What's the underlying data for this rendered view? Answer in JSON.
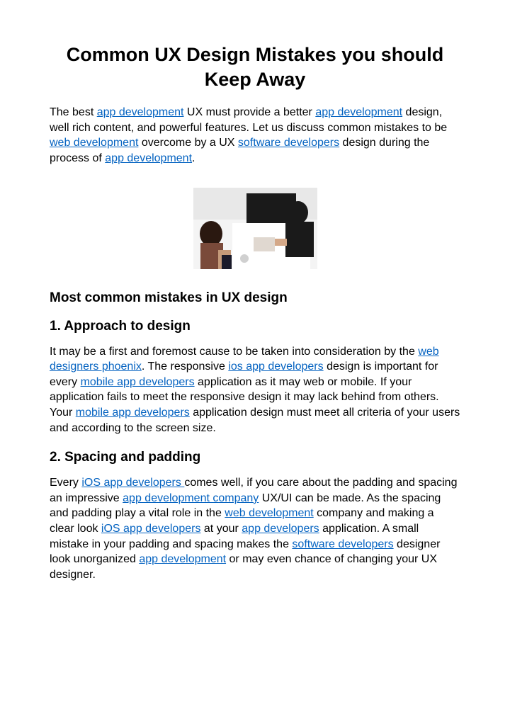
{
  "title": "Common UX Design Mistakes you should Keep Away",
  "intro": {
    "t1": "The best ",
    "l1": "app development",
    "t2": " UX must provide a better ",
    "l2": "app development",
    "t3": " design, well rich content, and powerful features. Let us discuss common mistakes to be ",
    "l3": "web development",
    "t4": " overcome by a UX ",
    "l4": "software developers",
    "t5": " design during the process of ",
    "l5": "app development",
    "t6": "."
  },
  "subheading": "Most common mistakes in UX design",
  "section1": {
    "heading": "1. Approach to design",
    "t1": "It may be a first and foremost cause to be taken into consideration by the ",
    "l1": "web designers phoenix",
    "t2": ". The responsive ",
    "l2": "ios app developers",
    "t3": " design is important for every ",
    "l3": "mobile app developers",
    "t4": " application as it may web or mobile. If your application fails to meet the responsive design it may lack behind from others. Your ",
    "l4": "mobile app developers",
    "t5": " application design must meet all criteria of your users and according to the screen size."
  },
  "section2": {
    "heading": "2. Spacing and padding",
    "t1": "Every ",
    "l1": "iOS app developers ",
    "t2": "comes well, if you care about the padding and spacing an impressive ",
    "l2": "app development company",
    "t3": " UX/UI can be made. As the spacing and padding play a vital role in the  ",
    "l3": "web development",
    "t4": "  company and making a clear look ",
    "l4": "iOS app developers",
    "t5": " at your ",
    "l5": "app developers",
    "t6": " application. A small mistake in your padding and spacing makes the ",
    "l6": "software developers",
    "t7": " designer  look unorganized ",
    "l7": "app development",
    "t8": " or may even chance of changing your UX designer."
  }
}
